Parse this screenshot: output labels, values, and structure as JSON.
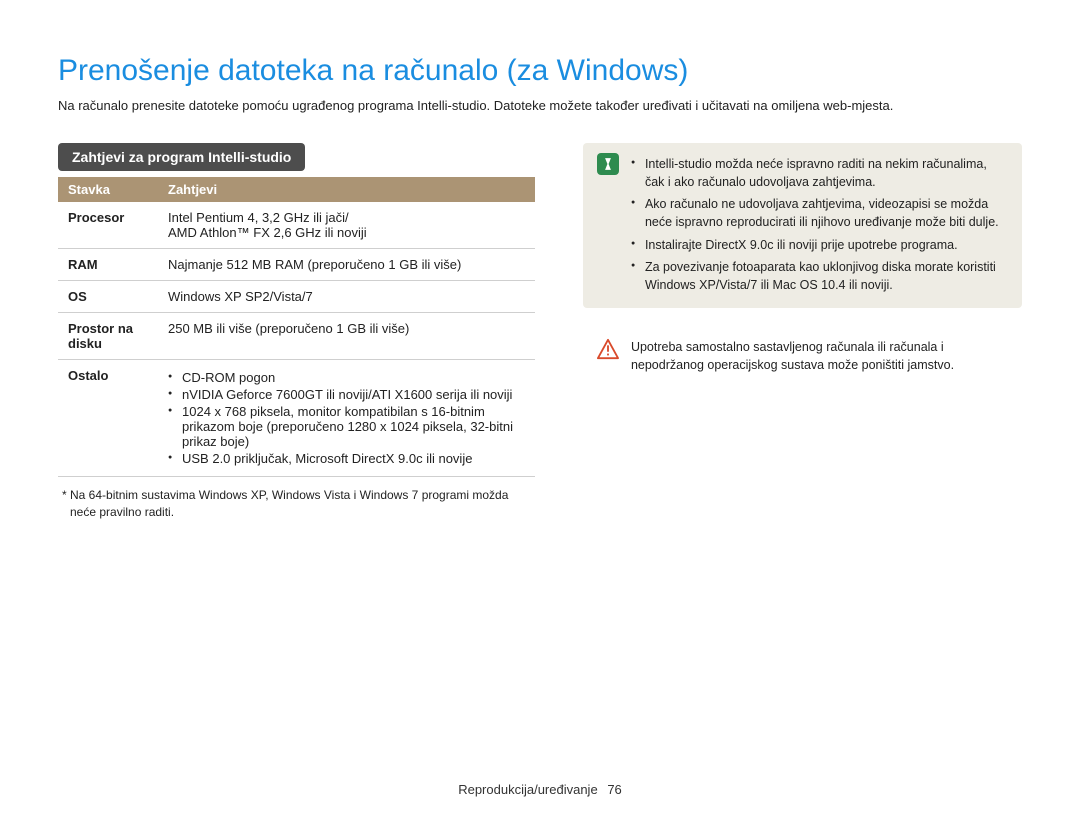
{
  "title": "Prenošenje datoteka na računalo (za Windows)",
  "intro": "Na računalo prenesite datoteke pomoću ugrađenog programa Intelli-studio. Datoteke možete također uređivati i učitavati na omiljena web-mjesta.",
  "section_heading": "Zahtjevi za program Intelli-studio",
  "table": {
    "head": {
      "c1": "Stavka",
      "c2": "Zahtjevi"
    },
    "rows": {
      "proc": {
        "label": "Procesor",
        "l1": "Intel Pentium 4, 3,2 GHz ili jači/",
        "l2": "AMD Athlon™ FX 2,6 GHz ili noviji"
      },
      "ram": {
        "label": "RAM",
        "val": "Najmanje 512 MB RAM (preporučeno 1 GB ili više)"
      },
      "os": {
        "label": "OS",
        "val": "Windows XP SP2/Vista/7"
      },
      "disk": {
        "label": "Prostor na disku",
        "val": "250 MB ili više (preporučeno 1 GB ili više)"
      },
      "other": {
        "label": "Ostalo",
        "b1": "CD-ROM pogon",
        "b2": "nVIDIA Geforce 7600GT ili noviji/ATI X1600 serija ili noviji",
        "b3": "1024 x 768 piksela, monitor kompatibilan s 16-bitnim prikazom boje (preporučeno 1280 x 1024 piksela, 32-bitni prikaz boje)",
        "b4": "USB 2.0 priključak, Microsoft DirectX 9.0c ili novije"
      }
    }
  },
  "footnote": "* Na 64-bitnim sustavima Windows XP, Windows Vista i Windows 7 programi možda neće pravilno raditi.",
  "note_info": {
    "b1": "Intelli-studio možda neće ispravno raditi na nekim računalima, čak i ako računalo udovoljava zahtjevima.",
    "b2": "Ako računalo ne udovoljava zahtjevima, videozapisi se možda neće ispravno reproducirati ili njihovo uređivanje može biti dulje.",
    "b3": "Instalirajte DirectX 9.0c ili noviji prije upotrebe programa.",
    "b4": "Za povezivanje fotoaparata kao uklonjivog diska morate koristiti Windows XP/Vista/7 ili Mac OS 10.4 ili noviji."
  },
  "note_warn": "Upotreba samostalno sastavljenog računala ili računala i nepodržanog operacijskog sustava može poništiti jamstvo.",
  "footer": {
    "section": "Reprodukcija/uređivanje",
    "page": "76"
  }
}
